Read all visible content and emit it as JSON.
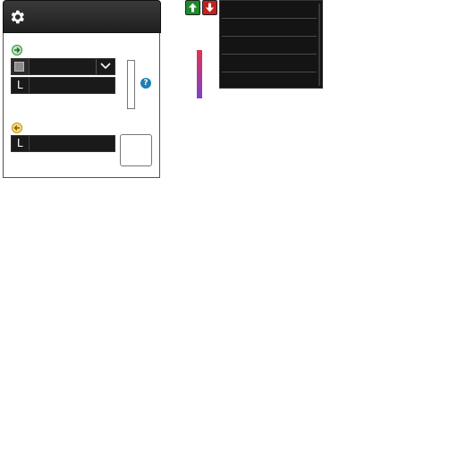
{
  "panel": {
    "settings_icon": "gear-icon",
    "input_icon": "arrow-right-circle-icon",
    "output_icon": "arrow-left-circle-icon",
    "input_select": {
      "value": "",
      "prefix_icon": "device-icon"
    },
    "input_field": {
      "prefix": "L",
      "value": ""
    },
    "output_field": {
      "prefix": "L",
      "value": ""
    },
    "help_label": "?"
  },
  "toolbar": {
    "up_icon": "arrow-up-icon",
    "down_icon": "arrow-down-icon"
  },
  "list": {
    "rows": [
      "",
      "",
      "",
      ""
    ]
  },
  "colors": {
    "header_bg": "#2a2a2a",
    "input_accent": "#2f8f3a",
    "output_accent": "#d3a21a",
    "up_button": "#1e8a2c",
    "down_button": "#c51f1f",
    "help_bg": "#1f7fb5",
    "gradient_top": "#e1324f",
    "gradient_bottom": "#7a43d1"
  }
}
